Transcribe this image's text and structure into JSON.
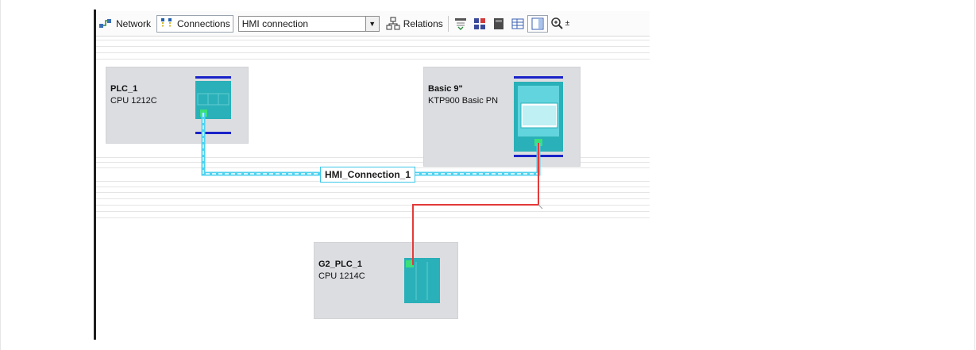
{
  "toolbar": {
    "network_label": "Network",
    "connections_label": "Connections",
    "connection_type": "HMI connection",
    "relations_label": "Relations"
  },
  "devices": [
    {
      "name": "PLC_1",
      "type": "CPU 1212C"
    },
    {
      "name": "Basic 9\"",
      "type": "KTP900 Basic PN"
    },
    {
      "name": "G2_PLC_1",
      "type": "CPU 1214C"
    }
  ],
  "connection": {
    "label": "HMI_Connection_1"
  },
  "colors": {
    "hmi_connection": "#4fd2ef",
    "profinet_wire": "#e43a3a",
    "device_body": "#2ab0b8",
    "device_panel": "#dcdde1",
    "rail": "#1a23c8"
  },
  "icons": [
    "network-icon",
    "connections-icon",
    "relations-icon",
    "address-view-icon",
    "topology-icon",
    "device-icon",
    "table-icon",
    "overview-icon",
    "zoom-icon"
  ]
}
